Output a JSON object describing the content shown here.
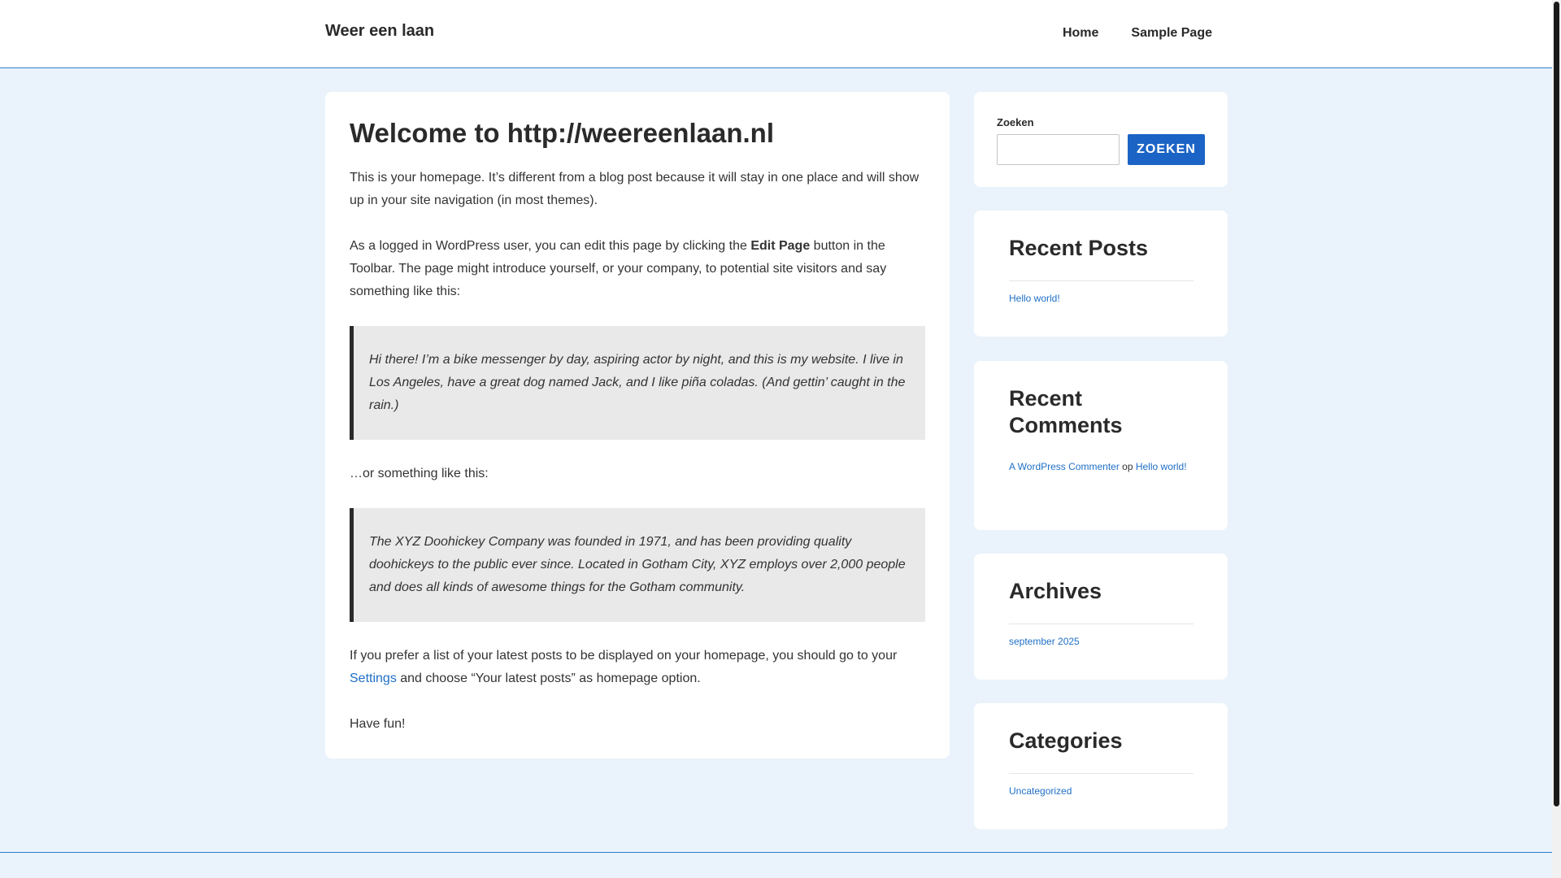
{
  "header": {
    "site_title": "Weer een laan",
    "nav": {
      "home": "Home",
      "sample_page": "Sample Page"
    }
  },
  "main": {
    "title": "Welcome to http://weereenlaan.nl",
    "p1": "This is your homepage. It’s different from a blog post because it will stay in one place and will show up in your site navigation (in most themes).",
    "p2_before": "As a logged in WordPress user, you can edit this page by clicking the ",
    "p2_bold": "Edit Page",
    "p2_after": " button in the Toolbar. The page might introduce yourself, or your company, to potential site visitors and say something like this:",
    "quote1": "Hi there! I’m a bike messenger by day, aspiring actor by night, and this is my website. I live in Los Angeles, have a great dog named Jack, and I like piña coladas. (And gettin’ caught in the rain.)",
    "p3": "…or something like this:",
    "quote2": "The XYZ Doohickey Company was founded in 1971, and has been providing quality doohickeys to the public ever since. Located in Gotham City, XYZ employs over 2,000 people and does all kinds of awesome things for the Gotham community.",
    "p4_before": "If you prefer a list of your latest posts to be displayed on your homepage, you should go to your ",
    "p4_link": "Settings",
    "p4_after": " and choose “Your latest posts” as homepage option.",
    "p5": "Have fun!"
  },
  "sidebar": {
    "search": {
      "label": "Zoeken",
      "button": "ZOEKEN",
      "value": ""
    },
    "recent_posts": {
      "title": "Recent Posts",
      "items": [
        "Hello world!"
      ]
    },
    "recent_comments": {
      "title": "Recent Comments",
      "author": "A WordPress Commenter",
      "joiner": " op ",
      "post": "Hello world!"
    },
    "archives": {
      "title": "Archives",
      "items": [
        "september 2025"
      ]
    },
    "categories": {
      "title": "Categories",
      "items": [
        "Uncategorized"
      ]
    }
  },
  "colors": {
    "background": "#eaf3fb",
    "accent": "#1b64c6",
    "link": "#1f6fc6",
    "border": "#2e7fd0"
  }
}
